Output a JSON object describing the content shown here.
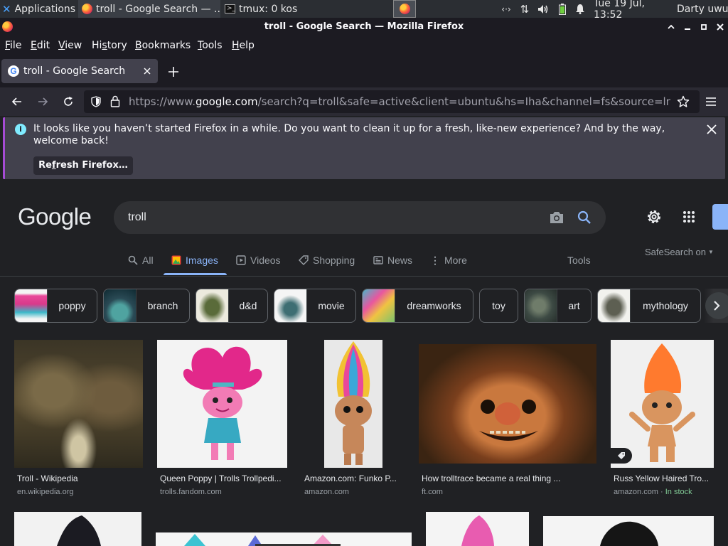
{
  "panel": {
    "apps_label": "Applications",
    "task1": "troll - Google Search — ...",
    "task2": "tmux: 0 kos",
    "clock": "Tue 19 Jul, 13:52",
    "user": "Darty uwu"
  },
  "window": {
    "title": "troll - Google Search — Mozilla Firefox"
  },
  "menubar": [
    {
      "u": "F",
      "rest": "ile"
    },
    {
      "u": "E",
      "rest": "dit"
    },
    {
      "u": "V",
      "rest": "iew"
    },
    {
      "u": "",
      "rest": "Hi",
      "u2": "s",
      "rest2": "tory"
    },
    {
      "u": "B",
      "rest": "ookmarks"
    },
    {
      "u": "T",
      "rest": "ools"
    },
    {
      "u": "H",
      "rest": "elp"
    }
  ],
  "tab": {
    "title": "troll - Google Search"
  },
  "urlbar": {
    "scheme": "https://www.",
    "host": "google.com",
    "path": "/search?q=troll&safe=active&client=ubuntu&hs=Iha&channel=fs&source=lnms&tbm=isch"
  },
  "notification": {
    "message": "It looks like you haven’t started Firefox in a while. Do you want to clean it up for a fresh, like-new experience? And by the way, welcome back!",
    "button_pre": "Re",
    "button_u": "f",
    "button_post": "resh Firefox…"
  },
  "google": {
    "logo": "Google",
    "query": "troll",
    "tabs": [
      "All",
      "Images",
      "Videos",
      "Shopping",
      "News",
      "More"
    ],
    "tools": "Tools",
    "safesearch": "SafeSearch on"
  },
  "chips": [
    "poppy",
    "branch",
    "d&d",
    "movie",
    "dreamworks",
    "toy",
    "art",
    "mythology"
  ],
  "results": [
    {
      "title": "Troll - Wikipedia",
      "source": "en.wikipedia.org",
      "extra": ""
    },
    {
      "title": "Queen Poppy | Trolls Trollpedi...",
      "source": "trolls.fandom.com",
      "extra": ""
    },
    {
      "title": "Amazon.com: Funko P...",
      "source": "amazon.com",
      "extra": ""
    },
    {
      "title": "How trolltrace became a real thing ...",
      "source": "ft.com",
      "extra": ""
    },
    {
      "title": "Russ Yellow Haired Tro...",
      "source": "amazon.com · ",
      "extra": "In stock"
    }
  ],
  "colors": {
    "accent": "#8ab4f8",
    "background": "#202124",
    "in_stock": "#81c995"
  }
}
